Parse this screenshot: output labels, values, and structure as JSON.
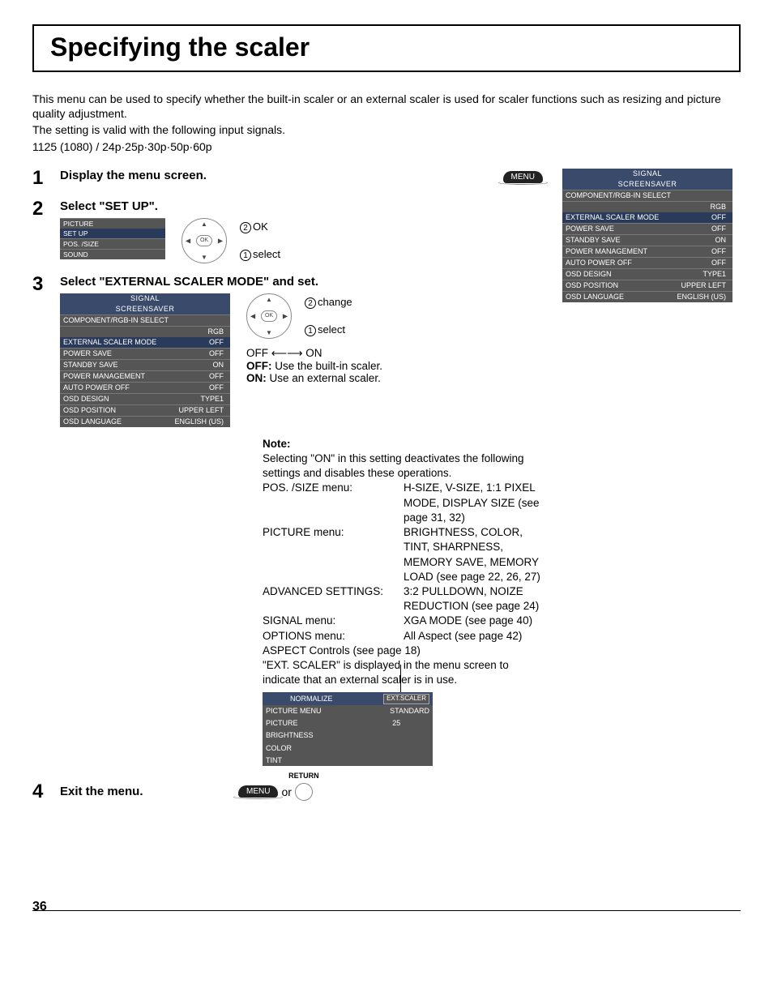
{
  "title": "Specifying the scaler",
  "intro": {
    "l1": "This menu can be used to specify whether the built-in scaler or an external scaler is used for scaler functions such as resizing and picture quality adjustment.",
    "l2": "The setting is valid with the following input signals.",
    "l3": "1125 (1080) / 24p·25p·30p·50p·60p"
  },
  "steps": {
    "s1": {
      "num": "1",
      "head": "Display the menu screen.",
      "btn": "MENU"
    },
    "s2": {
      "num": "2",
      "head": "Select \"SET UP\".",
      "menu": [
        "PICTURE",
        "SET UP",
        "POS. /SIZE",
        "SOUND"
      ],
      "ok": "OK",
      "labels": {
        "ok": "OK",
        "select": "select"
      }
    },
    "s3": {
      "num": "3",
      "head": "Select \"EXTERNAL SCALER MODE\" and set.",
      "osd": [
        [
          "SIGNAL",
          ""
        ],
        [
          "SCREENSAVER",
          ""
        ],
        [
          "COMPONENT/RGB-IN SELECT",
          ""
        ],
        [
          "",
          "RGB"
        ],
        [
          "EXTERNAL SCALER MODE",
          "OFF"
        ],
        [
          "POWER SAVE",
          "OFF"
        ],
        [
          "STANDBY SAVE",
          "ON"
        ],
        [
          "POWER MANAGEMENT",
          "OFF"
        ],
        [
          "AUTO POWER OFF",
          "OFF"
        ],
        [
          "OSD DESIGN",
          "TYPE1"
        ],
        [
          "OSD POSITION",
          "UPPER LEFT"
        ],
        [
          "OSD LANGUAGE",
          "ENGLISH (US)"
        ]
      ],
      "labels": {
        "change": "change",
        "select": "select"
      },
      "toggle": "OFF ⟵⟶ ON",
      "off": {
        "h": "OFF:",
        "t": " Use the built-in scaler."
      },
      "on": {
        "h": "ON:",
        "t": " Use an external scaler."
      },
      "note": {
        "title": "Note:",
        "lead": "Selecting \"ON\" in this setting deactivates the following settings and disables these operations.",
        "defs": [
          [
            "POS. /SIZE menu:",
            "H-SIZE, V-SIZE, 1:1 PIXEL MODE, DISPLAY SIZE (see page 31, 32)"
          ],
          [
            "PICTURE menu:",
            "BRIGHTNESS, COLOR, TINT, SHARPNESS, MEMORY SAVE, MEMORY LOAD (see page 22, 26, 27)"
          ],
          [
            "ADVANCED SETTINGS:",
            "3:2 PULLDOWN, NOIZE REDUCTION (see page 24)"
          ],
          [
            "SIGNAL menu:",
            "XGA MODE (see page 40)"
          ],
          [
            "OPTIONS menu:",
            "All Aspect (see page 42)"
          ]
        ],
        "aspect": "ASPECT Controls (see page 18)",
        "ext": "\"EXT. SCALER\" is displayed in the menu screen to indicate that an external scaler is in use.",
        "ext_menu": {
          "badge": "EXT.SCALER",
          "rows": [
            [
              "NORMALIZE",
              ""
            ],
            [
              "PICTURE MENU",
              "STANDARD"
            ],
            [
              "PICTURE",
              "25"
            ],
            [
              "BRIGHTNESS",
              ""
            ],
            [
              "COLOR",
              ""
            ],
            [
              "TINT",
              ""
            ]
          ]
        }
      }
    },
    "s4": {
      "num": "4",
      "head": "Exit the menu.",
      "btn": "MENU",
      "or": " or ",
      "ret": "RETURN"
    }
  },
  "sidebar_osd": [
    [
      "SIGNAL",
      ""
    ],
    [
      "SCREENSAVER",
      ""
    ],
    [
      "COMPONENT/RGB-IN SELECT",
      ""
    ],
    [
      "",
      "RGB"
    ],
    [
      "EXTERNAL SCALER MODE",
      "OFF"
    ],
    [
      "POWER SAVE",
      "OFF"
    ],
    [
      "STANDBY SAVE",
      "ON"
    ],
    [
      "POWER MANAGEMENT",
      "OFF"
    ],
    [
      "AUTO POWER OFF",
      "OFF"
    ],
    [
      "OSD DESIGN",
      "TYPE1"
    ],
    [
      "OSD POSITION",
      "UPPER LEFT"
    ],
    [
      "OSD LANGUAGE",
      "ENGLISH (US)"
    ]
  ],
  "page_num": "36"
}
